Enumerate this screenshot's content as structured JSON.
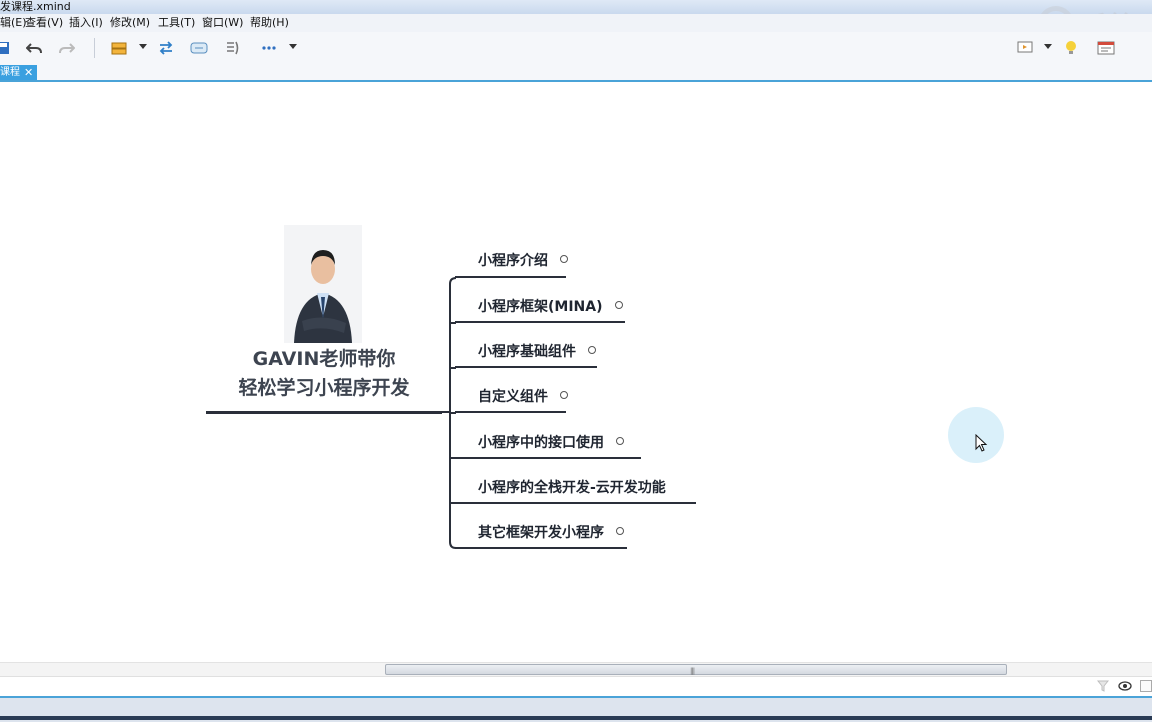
{
  "window": {
    "title": "发课程.xmind"
  },
  "menu": [
    "辑(E)",
    "查看(V)",
    "插入(I)",
    "修改(M)",
    "工具(T)",
    "窗口(W)",
    "帮助(H)"
  ],
  "tab": {
    "label": "课程",
    "close": "✕"
  },
  "mindmap": {
    "central_line1": "GAVIN老师带你",
    "central_line2": "轻松学习小程序开发",
    "branches": [
      {
        "label": "小程序介绍",
        "collapsed": true
      },
      {
        "label": "小程序框架(MINA)",
        "collapsed": true
      },
      {
        "label": "小程序基础组件",
        "collapsed": true
      },
      {
        "label": "自定义组件",
        "collapsed": true
      },
      {
        "label": "小程序中的接口使用",
        "collapsed": true
      },
      {
        "label": "小程序的全栈开发-云开发功能",
        "collapsed": false
      },
      {
        "label": "其它框架开发小程序",
        "collapsed": true
      }
    ]
  },
  "colors": {
    "accent": "#3aa0e0",
    "line": "#2a2f3a"
  }
}
